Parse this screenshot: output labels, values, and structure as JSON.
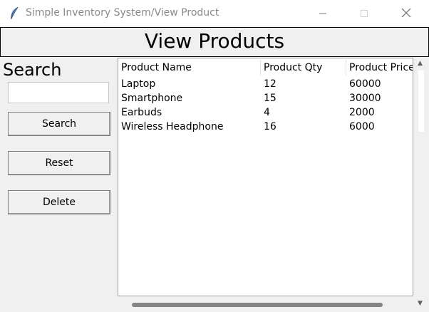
{
  "window": {
    "title": "Simple Inventory System/View Product",
    "controls": [
      "minimize-icon",
      "maximize-icon",
      "close-icon"
    ]
  },
  "header": {
    "title": "View Products"
  },
  "sidebar": {
    "search_label": "Search",
    "search_value": "",
    "buttons": {
      "search": "Search",
      "reset": "Reset",
      "delete": "Delete"
    }
  },
  "table": {
    "columns": [
      "Product Name",
      "Product Qty",
      "Product Price"
    ],
    "rows": [
      [
        "Laptop",
        "12",
        "60000"
      ],
      [
        "Smartphone",
        "15",
        "30000"
      ],
      [
        "Earbuds",
        "4",
        "2000"
      ],
      [
        "Wireless Headphone",
        "16",
        "6000"
      ]
    ]
  }
}
